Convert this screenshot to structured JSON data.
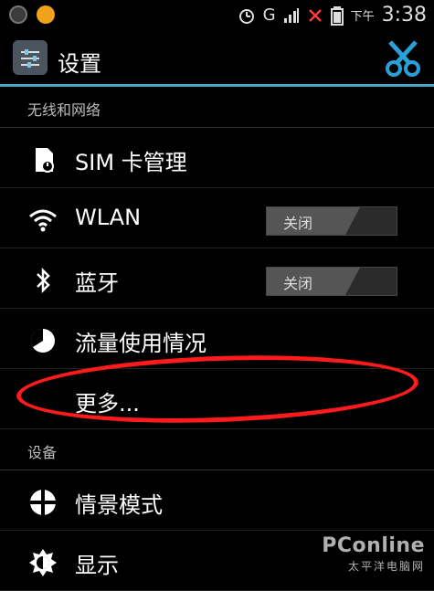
{
  "status_bar": {
    "network_label": "G",
    "ampm": "下午",
    "time": "3:38"
  },
  "action_bar": {
    "title": "设置"
  },
  "sections": {
    "wireless": "无线和网络",
    "device": "设备"
  },
  "items": {
    "sim": "SIM 卡管理",
    "wlan": "WLAN",
    "bluetooth": "蓝牙",
    "data_usage": "流量使用情况",
    "more": "更多...",
    "profiles": "情景模式",
    "display": "显示"
  },
  "toggles": {
    "wlan": "关闭",
    "bluetooth": "关闭"
  },
  "watermark": {
    "main": "PConline",
    "sub": "太平洋电脑网"
  },
  "colors": {
    "accent": "#4aa3c8",
    "annotation": "#ff1b1b"
  }
}
